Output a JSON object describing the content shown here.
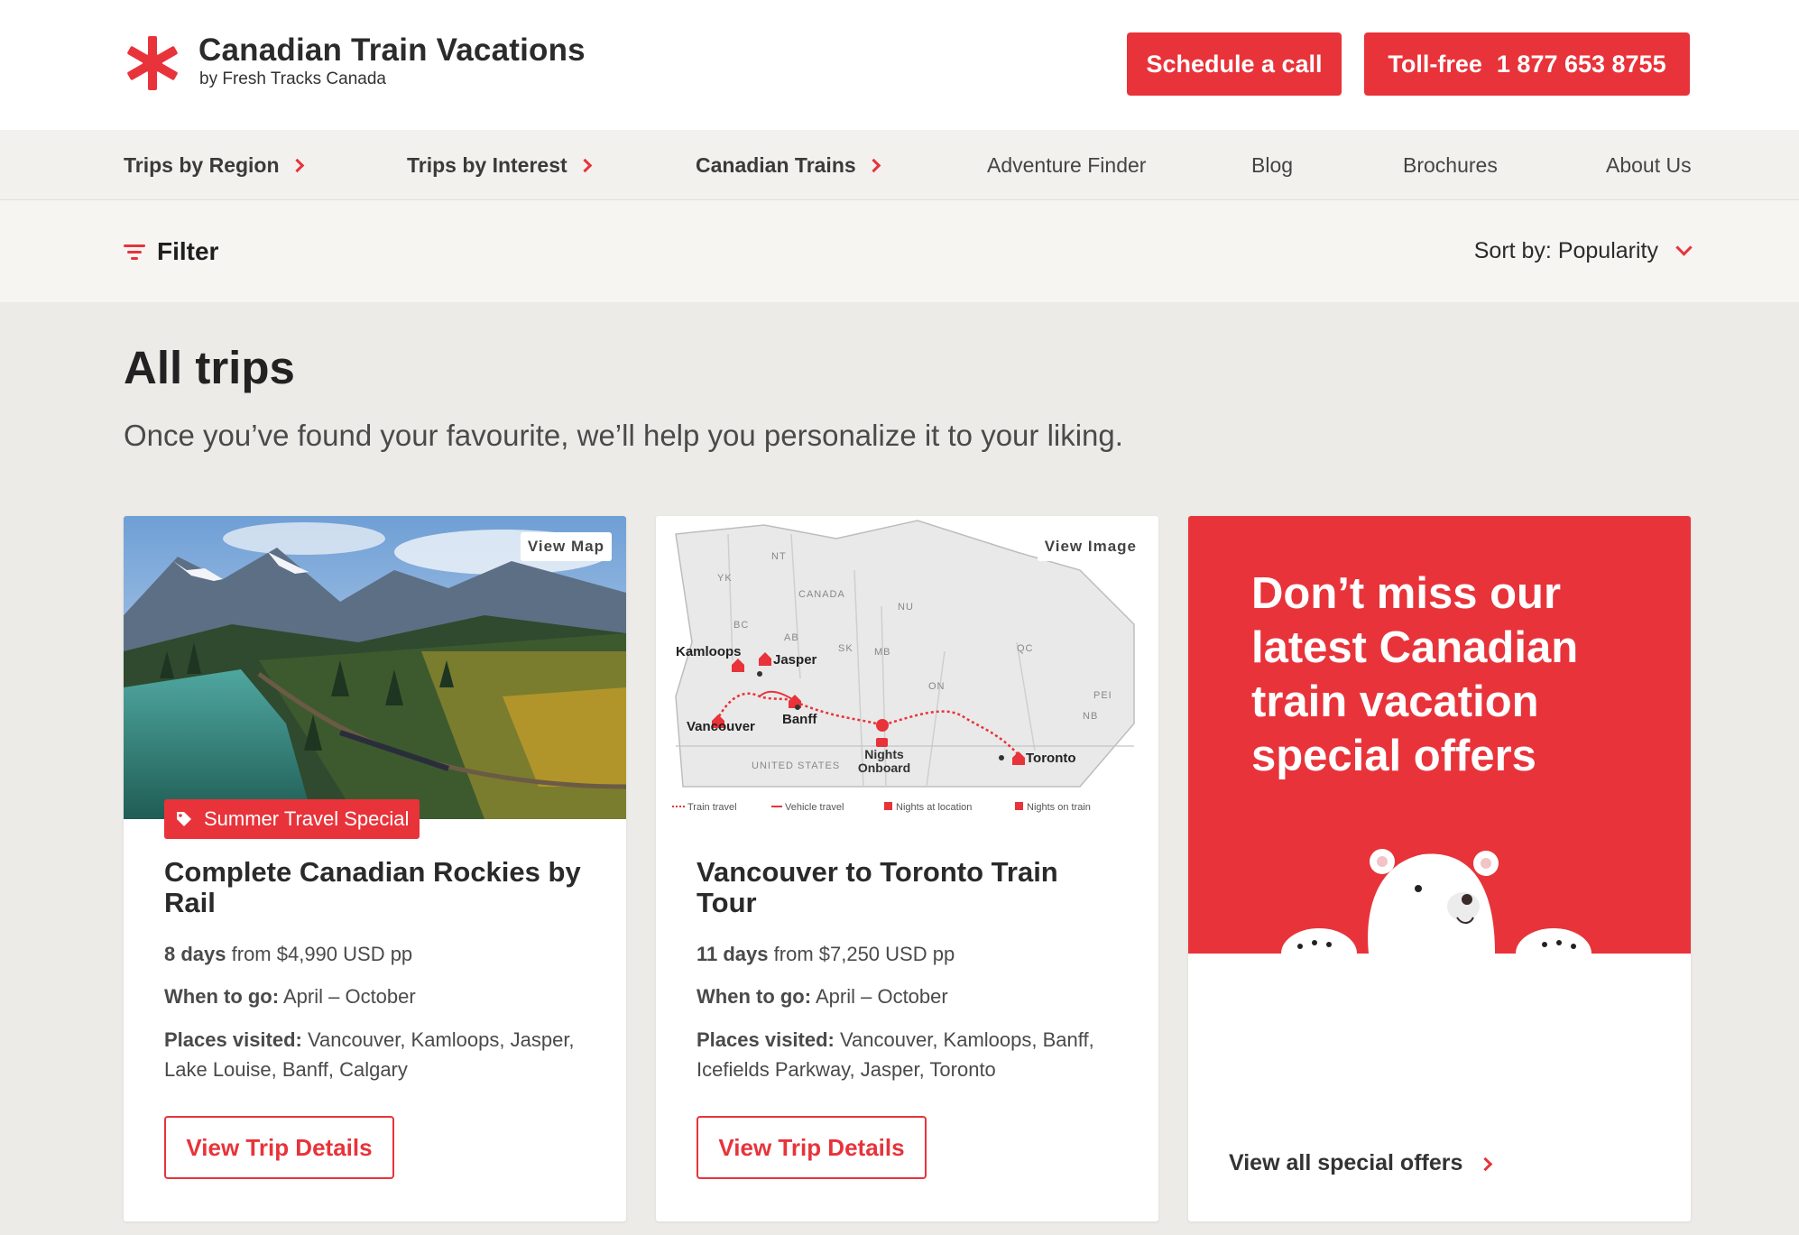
{
  "header": {
    "brand_title": "Canadian Train Vacations",
    "brand_sub": "by Fresh Tracks Canada",
    "schedule_label": "Schedule a call",
    "tollfree_label": "Toll-free",
    "tollfree_number": "1 877 653 8755"
  },
  "nav": {
    "items": [
      {
        "label": "Trips by Region"
      },
      {
        "label": "Trips by Interest"
      },
      {
        "label": "Canadian Trains"
      },
      {
        "label": "Adventure Finder"
      },
      {
        "label": "Blog"
      },
      {
        "label": "Brochures"
      },
      {
        "label": "About Us"
      }
    ]
  },
  "filterbar": {
    "filter_label": "Filter",
    "sort_label": "Sort by: Popularity"
  },
  "page": {
    "title": "All trips",
    "subtitle": "Once you’ve found your favourite, we’ll help you personalize it to your liking."
  },
  "cards": [
    {
      "view_tag": "View Map",
      "special_tag": "Summer Travel Special",
      "title": "Complete Canadian Rockies by Rail",
      "days": "8 days",
      "price": "from $4,990 USD pp",
      "when_label": "When to go:",
      "when_value": "April – October",
      "places_label": "Places visited:",
      "places_value": "Vancouver, Kamloops, Jasper, Lake Louise, Banff, Calgary",
      "button": "View Trip Details"
    },
    {
      "view_tag": "View Image",
      "title": "Vancouver to Toronto Train Tour",
      "days": "11 days",
      "price": "from $7,250 USD pp",
      "when_label": "When to go:",
      "when_value": "April – October",
      "places_label": "Places visited:",
      "places_value": "Vancouver, Kamloops, Banff, Icefields Parkway, Jasper, Toronto",
      "button": "View Trip Details"
    }
  ],
  "map": {
    "regions": [
      "YK",
      "NT",
      "NU",
      "CANADA",
      "BC",
      "AB",
      "SK",
      "MB",
      "ON",
      "QC",
      "PEI",
      "NB",
      "UNITED STATES"
    ],
    "cities": [
      "Kamloops",
      "Jasper",
      "Vancouver",
      "Banff",
      "Toronto"
    ],
    "nights_onboard": [
      "Nights",
      "Onboard"
    ],
    "legend": [
      "Train travel",
      "Vehicle travel",
      "Nights at location",
      "Nights on train"
    ]
  },
  "promo": {
    "headline": "Don’t miss our latest Canadian train vacation special offers",
    "link": "View all special offers"
  },
  "colors": {
    "brand_red": "#e8333a",
    "page_bg": "#ecebe7",
    "text_dark": "#2a2a2a"
  },
  "icons": [
    "maple-leaf-logo-icon",
    "chevron-right-icon",
    "filter-icon",
    "chevron-down-icon",
    "price-tag-icon",
    "polar-bear-illustration"
  ]
}
